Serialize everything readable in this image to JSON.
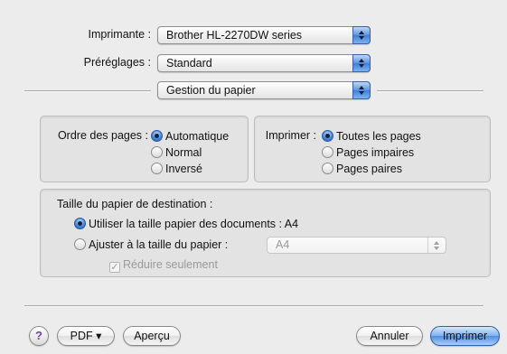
{
  "header": {
    "printer_label": "Imprimante :",
    "printer_value": "Brother HL-2270DW series",
    "presets_label": "Préréglages :",
    "presets_value": "Standard",
    "panel_value": "Gestion du papier"
  },
  "page_order": {
    "label": "Ordre des pages :",
    "options": [
      {
        "label": "Automatique",
        "selected": true
      },
      {
        "label": "Normal",
        "selected": false
      },
      {
        "label": "Inversé",
        "selected": false
      }
    ]
  },
  "print_pages": {
    "label": "Imprimer :",
    "options": [
      {
        "label": "Toutes les pages",
        "selected": true
      },
      {
        "label": "Pages impaires",
        "selected": false
      },
      {
        "label": "Pages paires",
        "selected": false
      }
    ]
  },
  "destination": {
    "title": "Taille du papier de destination :",
    "use_document_size": {
      "label": "Utiliser la taille papier des documents : A4",
      "selected": true
    },
    "fit_to_paper": {
      "label": "Ajuster à la taille du papier :",
      "selected": false,
      "value": "A4"
    },
    "scale_down_only": {
      "label": "Réduire seulement",
      "checked": true
    }
  },
  "footer": {
    "help_glyph": "?",
    "pdf_label": "PDF ▾",
    "preview_label": "Aperçu",
    "cancel_label": "Annuler",
    "print_label": "Imprimer"
  },
  "colors": {
    "accent": "#4f8ee5",
    "window_bg": "#ececec"
  }
}
